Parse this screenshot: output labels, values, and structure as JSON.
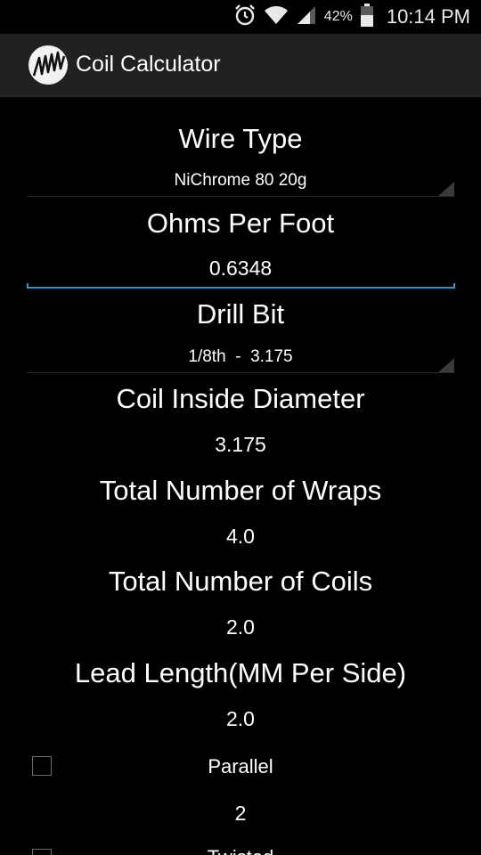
{
  "status_bar": {
    "battery_percent": "42%",
    "time": "10:14 PM",
    "icons": [
      "alarm-icon",
      "wifi-icon",
      "signal-icon",
      "battery-icon"
    ]
  },
  "app": {
    "title": "Coil Calculator",
    "icon": "coil-spring-icon"
  },
  "form": {
    "wire_type": {
      "label": "Wire Type",
      "selected": "NiChrome 80 20g"
    },
    "ohms_per_foot": {
      "label": "Ohms Per Foot",
      "value": "0.6348"
    },
    "drill_bit": {
      "label": "Drill Bit",
      "selected": "1/8th  -  3.175"
    },
    "coil_inside_diameter": {
      "label": "Coil Inside Diameter",
      "value": "3.175"
    },
    "total_wraps": {
      "label": "Total Number of Wraps",
      "value": "4.0"
    },
    "total_coils": {
      "label": "Total Number of Coils",
      "value": "2.0"
    },
    "lead_length": {
      "label": "Lead Length(MM Per Side)",
      "value": "2.0"
    },
    "parallel": {
      "label": "Parallel",
      "checked": false,
      "value": "2"
    },
    "twisted": {
      "label": "Twisted",
      "checked": false
    }
  },
  "colors": {
    "accent": "#2f96c8",
    "action_bar": "#212121",
    "background": "#000000"
  }
}
